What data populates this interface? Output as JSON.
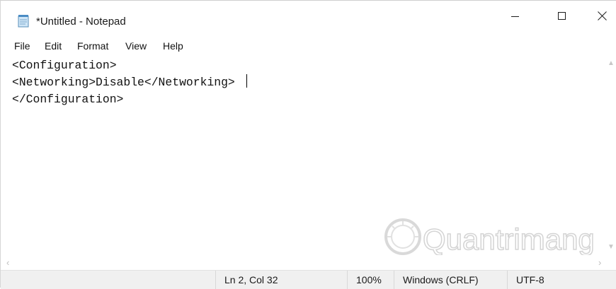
{
  "window": {
    "title": "*Untitled - Notepad"
  },
  "menu": {
    "items": [
      "File",
      "Edit",
      "Format",
      "View",
      "Help"
    ]
  },
  "editor": {
    "lines": [
      "<Configuration>",
      "<Networking>Disable</Networking>",
      "</Configuration>"
    ]
  },
  "statusbar": {
    "position": "Ln 2, Col 32",
    "zoom": "100%",
    "line_ending": "Windows (CRLF)",
    "encoding": "UTF-8"
  },
  "icons": {
    "app": "notepad-icon",
    "minimize": "minimize-icon",
    "maximize": "maximize-icon",
    "close": "close-icon"
  },
  "watermark": {
    "brand": "Quantrimang"
  }
}
